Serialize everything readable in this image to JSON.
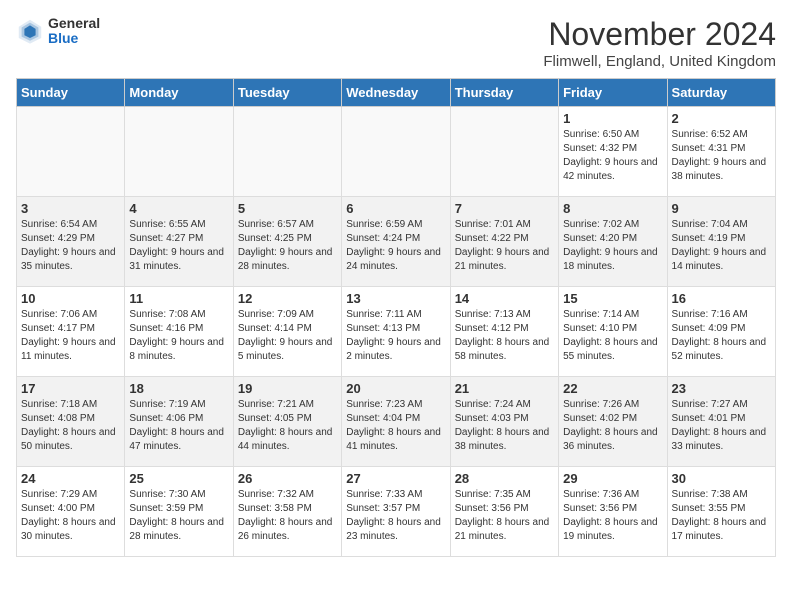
{
  "header": {
    "logo_general": "General",
    "logo_blue": "Blue",
    "month_title": "November 2024",
    "location": "Flimwell, England, United Kingdom"
  },
  "days_of_week": [
    "Sunday",
    "Monday",
    "Tuesday",
    "Wednesday",
    "Thursday",
    "Friday",
    "Saturday"
  ],
  "weeks": [
    [
      {
        "day": "",
        "info": ""
      },
      {
        "day": "",
        "info": ""
      },
      {
        "day": "",
        "info": ""
      },
      {
        "day": "",
        "info": ""
      },
      {
        "day": "",
        "info": ""
      },
      {
        "day": "1",
        "info": "Sunrise: 6:50 AM\nSunset: 4:32 PM\nDaylight: 9 hours and 42 minutes."
      },
      {
        "day": "2",
        "info": "Sunrise: 6:52 AM\nSunset: 4:31 PM\nDaylight: 9 hours and 38 minutes."
      }
    ],
    [
      {
        "day": "3",
        "info": "Sunrise: 6:54 AM\nSunset: 4:29 PM\nDaylight: 9 hours and 35 minutes."
      },
      {
        "day": "4",
        "info": "Sunrise: 6:55 AM\nSunset: 4:27 PM\nDaylight: 9 hours and 31 minutes."
      },
      {
        "day": "5",
        "info": "Sunrise: 6:57 AM\nSunset: 4:25 PM\nDaylight: 9 hours and 28 minutes."
      },
      {
        "day": "6",
        "info": "Sunrise: 6:59 AM\nSunset: 4:24 PM\nDaylight: 9 hours and 24 minutes."
      },
      {
        "day": "7",
        "info": "Sunrise: 7:01 AM\nSunset: 4:22 PM\nDaylight: 9 hours and 21 minutes."
      },
      {
        "day": "8",
        "info": "Sunrise: 7:02 AM\nSunset: 4:20 PM\nDaylight: 9 hours and 18 minutes."
      },
      {
        "day": "9",
        "info": "Sunrise: 7:04 AM\nSunset: 4:19 PM\nDaylight: 9 hours and 14 minutes."
      }
    ],
    [
      {
        "day": "10",
        "info": "Sunrise: 7:06 AM\nSunset: 4:17 PM\nDaylight: 9 hours and 11 minutes."
      },
      {
        "day": "11",
        "info": "Sunrise: 7:08 AM\nSunset: 4:16 PM\nDaylight: 9 hours and 8 minutes."
      },
      {
        "day": "12",
        "info": "Sunrise: 7:09 AM\nSunset: 4:14 PM\nDaylight: 9 hours and 5 minutes."
      },
      {
        "day": "13",
        "info": "Sunrise: 7:11 AM\nSunset: 4:13 PM\nDaylight: 9 hours and 2 minutes."
      },
      {
        "day": "14",
        "info": "Sunrise: 7:13 AM\nSunset: 4:12 PM\nDaylight: 8 hours and 58 minutes."
      },
      {
        "day": "15",
        "info": "Sunrise: 7:14 AM\nSunset: 4:10 PM\nDaylight: 8 hours and 55 minutes."
      },
      {
        "day": "16",
        "info": "Sunrise: 7:16 AM\nSunset: 4:09 PM\nDaylight: 8 hours and 52 minutes."
      }
    ],
    [
      {
        "day": "17",
        "info": "Sunrise: 7:18 AM\nSunset: 4:08 PM\nDaylight: 8 hours and 50 minutes."
      },
      {
        "day": "18",
        "info": "Sunrise: 7:19 AM\nSunset: 4:06 PM\nDaylight: 8 hours and 47 minutes."
      },
      {
        "day": "19",
        "info": "Sunrise: 7:21 AM\nSunset: 4:05 PM\nDaylight: 8 hours and 44 minutes."
      },
      {
        "day": "20",
        "info": "Sunrise: 7:23 AM\nSunset: 4:04 PM\nDaylight: 8 hours and 41 minutes."
      },
      {
        "day": "21",
        "info": "Sunrise: 7:24 AM\nSunset: 4:03 PM\nDaylight: 8 hours and 38 minutes."
      },
      {
        "day": "22",
        "info": "Sunrise: 7:26 AM\nSunset: 4:02 PM\nDaylight: 8 hours and 36 minutes."
      },
      {
        "day": "23",
        "info": "Sunrise: 7:27 AM\nSunset: 4:01 PM\nDaylight: 8 hours and 33 minutes."
      }
    ],
    [
      {
        "day": "24",
        "info": "Sunrise: 7:29 AM\nSunset: 4:00 PM\nDaylight: 8 hours and 30 minutes."
      },
      {
        "day": "25",
        "info": "Sunrise: 7:30 AM\nSunset: 3:59 PM\nDaylight: 8 hours and 28 minutes."
      },
      {
        "day": "26",
        "info": "Sunrise: 7:32 AM\nSunset: 3:58 PM\nDaylight: 8 hours and 26 minutes."
      },
      {
        "day": "27",
        "info": "Sunrise: 7:33 AM\nSunset: 3:57 PM\nDaylight: 8 hours and 23 minutes."
      },
      {
        "day": "28",
        "info": "Sunrise: 7:35 AM\nSunset: 3:56 PM\nDaylight: 8 hours and 21 minutes."
      },
      {
        "day": "29",
        "info": "Sunrise: 7:36 AM\nSunset: 3:56 PM\nDaylight: 8 hours and 19 minutes."
      },
      {
        "day": "30",
        "info": "Sunrise: 7:38 AM\nSunset: 3:55 PM\nDaylight: 8 hours and 17 minutes."
      }
    ]
  ]
}
